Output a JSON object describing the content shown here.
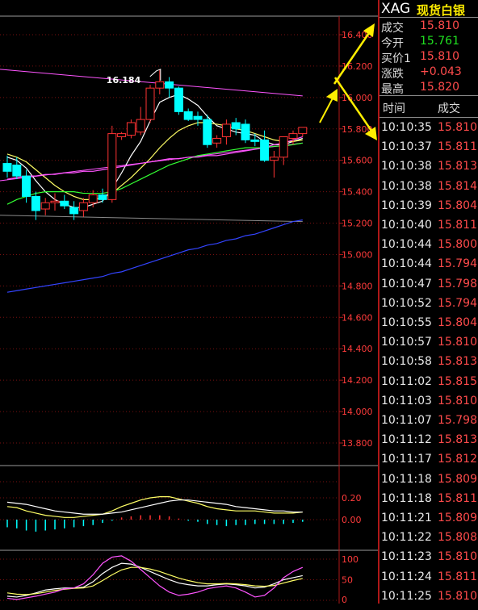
{
  "colors": {
    "up": "#ff3333",
    "down": "#00ffff",
    "ma5": "#ffffff",
    "ma10": "#ffff66",
    "ma20": "#33ff33",
    "ma60": "#ff55ff",
    "ma120": "#3344ff",
    "annotation": "#ffee00"
  },
  "quote": {
    "symbol": "XAG",
    "name": "现货白银",
    "rows": [
      {
        "label": "成交",
        "value": "15.810",
        "color": "red"
      },
      {
        "label": "今开",
        "value": "15.761",
        "color": "green"
      },
      {
        "label": "买价1",
        "value": "15.810",
        "color": "red"
      },
      {
        "label": "涨跌",
        "value": "+0.043",
        "color": "red"
      },
      {
        "label": "最高",
        "value": "15.820",
        "color": "red"
      }
    ]
  },
  "ticks": {
    "header_time": "时间",
    "header_price": "成交",
    "rows": [
      {
        "time": "10:10:35",
        "price": "15.810"
      },
      {
        "time": "10:10:37",
        "price": "15.811"
      },
      {
        "time": "10:10:38",
        "price": "15.813"
      },
      {
        "time": "10:10:38",
        "price": "15.814"
      },
      {
        "time": "10:10:39",
        "price": "15.804"
      },
      {
        "time": "10:10:40",
        "price": "15.811"
      },
      {
        "time": "10:10:44",
        "price": "15.800"
      },
      {
        "time": "10:10:44",
        "price": "15.794"
      },
      {
        "time": "10:10:47",
        "price": "15.798"
      },
      {
        "time": "10:10:52",
        "price": "15.794"
      },
      {
        "time": "10:10:55",
        "price": "15.804"
      },
      {
        "time": "10:10:57",
        "price": "15.810"
      },
      {
        "time": "10:10:58",
        "price": "15.813"
      },
      {
        "time": "10:11:02",
        "price": "15.815"
      },
      {
        "time": "10:11:03",
        "price": "15.810"
      },
      {
        "time": "10:11:07",
        "price": "15.798"
      },
      {
        "time": "10:11:12",
        "price": "15.813"
      },
      {
        "time": "10:11:17",
        "price": "15.812"
      },
      {
        "time": "10:11:18",
        "price": "15.809"
      },
      {
        "time": "10:11:18",
        "price": "15.811"
      },
      {
        "time": "10:11:21",
        "price": "15.809"
      },
      {
        "time": "10:11:22",
        "price": "15.808"
      },
      {
        "time": "10:11:23",
        "price": "15.810"
      },
      {
        "time": "10:11:24",
        "price": "15.811"
      },
      {
        "time": "10:11:25",
        "price": "15.810"
      }
    ]
  },
  "chart_data": [
    {
      "type": "candlestick",
      "title": "",
      "y_ticks": [
        "16.400",
        "16.200",
        "16.000",
        "15.800",
        "15.600",
        "15.400",
        "15.200",
        "15.000",
        "14.800",
        "14.600",
        "14.400",
        "14.200",
        "14.000",
        "13.800"
      ],
      "ylim": [
        13.72,
        16.44
      ],
      "annotation": "16.184",
      "candles": [
        {
          "o": 15.58,
          "h": 15.63,
          "l": 15.49,
          "c": 15.53
        },
        {
          "o": 15.57,
          "h": 15.62,
          "l": 15.48,
          "c": 15.5
        },
        {
          "o": 15.5,
          "h": 15.54,
          "l": 15.33,
          "c": 15.37
        },
        {
          "o": 15.37,
          "h": 15.4,
          "l": 15.22,
          "c": 15.28
        },
        {
          "o": 15.29,
          "h": 15.36,
          "l": 15.25,
          "c": 15.33
        },
        {
          "o": 15.33,
          "h": 15.39,
          "l": 15.28,
          "c": 15.34
        },
        {
          "o": 15.34,
          "h": 15.38,
          "l": 15.29,
          "c": 15.31
        },
        {
          "o": 15.3,
          "h": 15.34,
          "l": 15.22,
          "c": 15.26
        },
        {
          "o": 15.28,
          "h": 15.36,
          "l": 15.24,
          "c": 15.33
        },
        {
          "o": 15.33,
          "h": 15.41,
          "l": 15.3,
          "c": 15.38
        },
        {
          "o": 15.38,
          "h": 15.42,
          "l": 15.33,
          "c": 15.35
        },
        {
          "o": 15.35,
          "h": 15.82,
          "l": 15.33,
          "c": 15.77
        },
        {
          "o": 15.75,
          "h": 15.78,
          "l": 15.73,
          "c": 15.77
        },
        {
          "o": 15.76,
          "h": 15.86,
          "l": 15.74,
          "c": 15.84
        },
        {
          "o": 15.78,
          "h": 15.94,
          "l": 15.76,
          "c": 15.86
        },
        {
          "o": 15.86,
          "h": 16.08,
          "l": 15.84,
          "c": 16.06
        },
        {
          "o": 16.06,
          "h": 16.18,
          "l": 16.02,
          "c": 16.1
        },
        {
          "o": 16.1,
          "h": 16.13,
          "l": 16.0,
          "c": 16.06
        },
        {
          "o": 16.06,
          "h": 16.07,
          "l": 15.89,
          "c": 15.91
        },
        {
          "o": 15.91,
          "h": 15.93,
          "l": 15.85,
          "c": 15.86
        },
        {
          "o": 15.88,
          "h": 15.91,
          "l": 15.82,
          "c": 15.86
        },
        {
          "o": 15.86,
          "h": 15.89,
          "l": 15.68,
          "c": 15.7
        },
        {
          "o": 15.71,
          "h": 15.76,
          "l": 15.68,
          "c": 15.74
        },
        {
          "o": 15.75,
          "h": 15.86,
          "l": 15.7,
          "c": 15.83
        },
        {
          "o": 15.84,
          "h": 15.87,
          "l": 15.76,
          "c": 15.8
        },
        {
          "o": 15.83,
          "h": 15.86,
          "l": 15.71,
          "c": 15.73
        },
        {
          "o": 15.73,
          "h": 15.77,
          "l": 15.69,
          "c": 15.72
        },
        {
          "o": 15.73,
          "h": 15.79,
          "l": 15.59,
          "c": 15.6
        },
        {
          "o": 15.6,
          "h": 15.66,
          "l": 15.49,
          "c": 15.62
        },
        {
          "o": 15.62,
          "h": 15.74,
          "l": 15.57,
          "c": 15.75
        },
        {
          "o": 15.74,
          "h": 15.79,
          "l": 15.7,
          "c": 15.77
        },
        {
          "o": 15.77,
          "h": 15.81,
          "l": 15.75,
          "c": 15.81
        }
      ],
      "ma_lines": [
        {
          "key": "ma5",
          "values": [
            15.62,
            15.6,
            15.55,
            15.47,
            15.4,
            15.35,
            15.32,
            15.3,
            15.3,
            15.32,
            15.34,
            15.42,
            15.52,
            15.63,
            15.72,
            15.85,
            15.97,
            16.0,
            16.02,
            15.99,
            15.95,
            15.88,
            15.82,
            15.8,
            15.78,
            15.77,
            15.76,
            15.72,
            15.7,
            15.7,
            15.72,
            15.74
          ]
        },
        {
          "key": "ma10",
          "values": [
            15.64,
            15.62,
            15.59,
            15.54,
            15.49,
            15.44,
            15.4,
            15.37,
            15.35,
            15.35,
            15.36,
            15.39,
            15.44,
            15.49,
            15.55,
            15.61,
            15.68,
            15.74,
            15.79,
            15.82,
            15.84,
            15.84,
            15.83,
            15.82,
            15.8,
            15.79,
            15.77,
            15.75,
            15.73,
            15.72,
            15.72,
            15.73
          ]
        },
        {
          "key": "ma20",
          "values": [
            15.32,
            15.35,
            15.37,
            15.39,
            15.4,
            15.4,
            15.4,
            15.4,
            15.39,
            15.39,
            15.39,
            15.4,
            15.42,
            15.45,
            15.48,
            15.51,
            15.54,
            15.57,
            15.59,
            15.61,
            15.63,
            15.64,
            15.65,
            15.66,
            15.67,
            15.68,
            15.68,
            15.68,
            15.69,
            15.69,
            15.7,
            15.71
          ]
        },
        {
          "key": "ma60",
          "values": [
            15.48,
            15.49,
            15.5,
            15.5,
            15.51,
            15.51,
            15.52,
            15.52,
            15.53,
            15.53,
            15.54,
            15.55,
            15.56,
            15.57,
            15.58,
            15.59,
            15.6,
            15.61,
            15.61,
            15.62,
            15.62,
            15.63,
            15.63,
            15.64,
            15.65,
            15.66,
            15.67,
            15.68,
            15.7,
            15.71,
            15.73,
            15.75
          ]
        },
        {
          "key": "ma120",
          "values": [
            14.76,
            14.77,
            14.78,
            14.79,
            14.8,
            14.81,
            14.82,
            14.83,
            14.84,
            14.85,
            14.86,
            14.88,
            14.89,
            14.91,
            14.93,
            14.95,
            14.97,
            14.99,
            15.01,
            15.03,
            15.04,
            15.06,
            15.07,
            15.09,
            15.1,
            15.12,
            15.13,
            15.15,
            15.17,
            15.19,
            15.21,
            15.22
          ]
        }
      ],
      "trendlines": [
        {
          "from": [
            0,
            16.18
          ],
          "to": [
            31,
            16.01
          ],
          "key": "ma60"
        },
        {
          "from": [
            0,
            15.25
          ],
          "to": [
            31,
            15.21
          ],
          "key": "gray"
        },
        {
          "from": [
            0,
            15.47
          ],
          "to": [
            31,
            15.71
          ],
          "key": "ma60"
        }
      ]
    },
    {
      "type": "line",
      "title": "",
      "y_ticks": [
        "0.20",
        "0.00"
      ],
      "ylim": [
        -0.16,
        0.3
      ],
      "series": [
        {
          "key": "fast",
          "values": [
            0.12,
            0.11,
            0.08,
            0.06,
            0.04,
            0.03,
            0.02,
            0.02,
            0.03,
            0.04,
            0.05,
            0.08,
            0.12,
            0.15,
            0.18,
            0.2,
            0.21,
            0.21,
            0.19,
            0.17,
            0.15,
            0.12,
            0.1,
            0.09,
            0.08,
            0.08,
            0.08,
            0.07,
            0.06,
            0.06,
            0.06,
            0.07
          ]
        },
        {
          "key": "slow",
          "values": [
            0.16,
            0.15,
            0.14,
            0.12,
            0.1,
            0.08,
            0.07,
            0.06,
            0.05,
            0.05,
            0.05,
            0.06,
            0.07,
            0.09,
            0.11,
            0.13,
            0.15,
            0.17,
            0.18,
            0.18,
            0.17,
            0.16,
            0.15,
            0.14,
            0.12,
            0.11,
            0.1,
            0.09,
            0.08,
            0.08,
            0.07,
            0.07
          ]
        }
      ],
      "bars": [
        -0.07,
        -0.08,
        -0.1,
        -0.11,
        -0.1,
        -0.09,
        -0.08,
        -0.07,
        -0.06,
        -0.05,
        -0.03,
        -0.01,
        0.02,
        0.03,
        0.04,
        0.04,
        0.04,
        0.03,
        0.01,
        -0.01,
        -0.02,
        -0.04,
        -0.05,
        -0.06,
        -0.05,
        -0.05,
        -0.04,
        -0.04,
        -0.04,
        -0.04,
        -0.03,
        -0.02
      ]
    },
    {
      "type": "line",
      "title": "",
      "y_ticks": [
        "100",
        "50",
        "0"
      ],
      "ylim": [
        0,
        110
      ],
      "series": [
        {
          "key": "k",
          "values": [
            10,
            8,
            12,
            18,
            25,
            28,
            30,
            30,
            32,
            45,
            65,
            80,
            90,
            88,
            80,
            70,
            60,
            50,
            42,
            38,
            35,
            35,
            38,
            40,
            38,
            35,
            30,
            32,
            40,
            50,
            55,
            60
          ]
        },
        {
          "key": "d",
          "values": [
            18,
            15,
            14,
            16,
            20,
            24,
            27,
            29,
            30,
            35,
            48,
            62,
            74,
            80,
            80,
            76,
            70,
            62,
            54,
            48,
            43,
            40,
            40,
            41,
            40,
            38,
            35,
            34,
            36,
            42,
            48,
            53
          ]
        },
        {
          "key": "j",
          "values": [
            5,
            2,
            6,
            10,
            15,
            20,
            28,
            30,
            40,
            62,
            90,
            105,
            108,
            95,
            75,
            55,
            35,
            20,
            12,
            15,
            20,
            28,
            32,
            35,
            30,
            20,
            8,
            12,
            30,
            55,
            70,
            80
          ]
        }
      ]
    }
  ]
}
